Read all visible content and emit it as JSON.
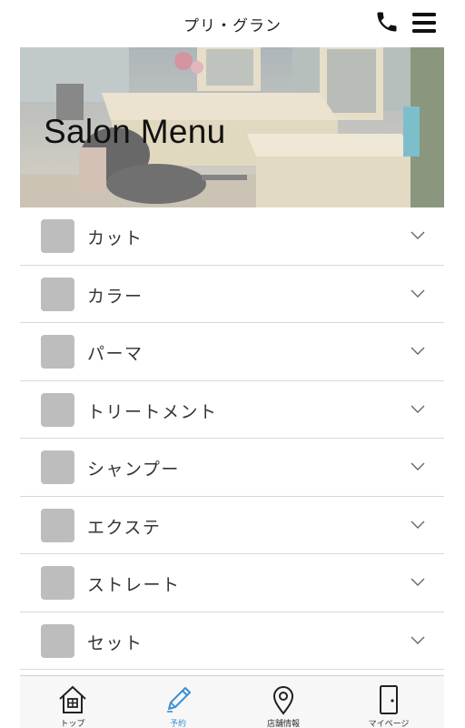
{
  "header": {
    "title": "プリ・グラン",
    "phone_icon": "phone-icon",
    "menu_icon": "hamburger-menu-icon"
  },
  "hero": {
    "title": "Salon Menu",
    "image": "salon-interior-photo"
  },
  "menu": {
    "items": [
      {
        "label": "カット"
      },
      {
        "label": "カラー"
      },
      {
        "label": "パーマ"
      },
      {
        "label": "トリートメント"
      },
      {
        "label": "シャンプー"
      },
      {
        "label": "エクステ"
      },
      {
        "label": "ストレート"
      },
      {
        "label": "セット"
      }
    ]
  },
  "tabbar": {
    "active_color": "#3a8fd0",
    "tabs": [
      {
        "label": "トップ",
        "icon": "home-icon"
      },
      {
        "label": "予約",
        "icon": "pencil-icon"
      },
      {
        "label": "店舗情報",
        "icon": "location-pin-icon"
      },
      {
        "label": "マイページ",
        "icon": "door-icon"
      }
    ]
  }
}
